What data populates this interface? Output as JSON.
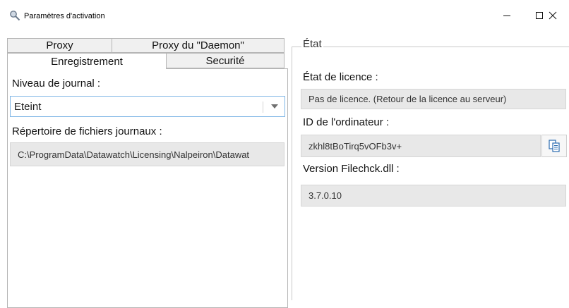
{
  "window": {
    "title": "Paramètres d'activation",
    "controls": {
      "minimize": "—",
      "maximize": "☐",
      "close": "✕"
    }
  },
  "tabs": {
    "row1": [
      "Proxy",
      "Proxy du \"Daemon\""
    ],
    "row2": [
      "Enregistrement",
      "Securité"
    ],
    "active": "Enregistrement"
  },
  "logging": {
    "level_label": "Niveau de journal :",
    "level_value": "Eteint",
    "dir_label": "Répertoire de fichiers journaux :",
    "dir_value": "C:\\ProgramData\\Datawatch\\Licensing\\Nalpeiron\\Datawat"
  },
  "status": {
    "group_title": "État",
    "license_label": "État de licence :",
    "license_value": "Pas de licence. (Retour de la licence au serveur)",
    "computer_id_label": "ID de l'ordinateur :",
    "computer_id_value": "zkhl8tBoTirq5vOFb3v+",
    "version_label": "Version Filechck.dll :",
    "version_value": "3.7.0.10"
  },
  "icons": {
    "app": "magnifier-key-icon",
    "copy": "copy-clipboard-icon",
    "dropdown": "chevron-down-icon"
  },
  "colors": {
    "accent_border": "#7fb6e6",
    "readonly_bg": "#e8e8e8",
    "tab_bg": "#f0f0f0"
  }
}
